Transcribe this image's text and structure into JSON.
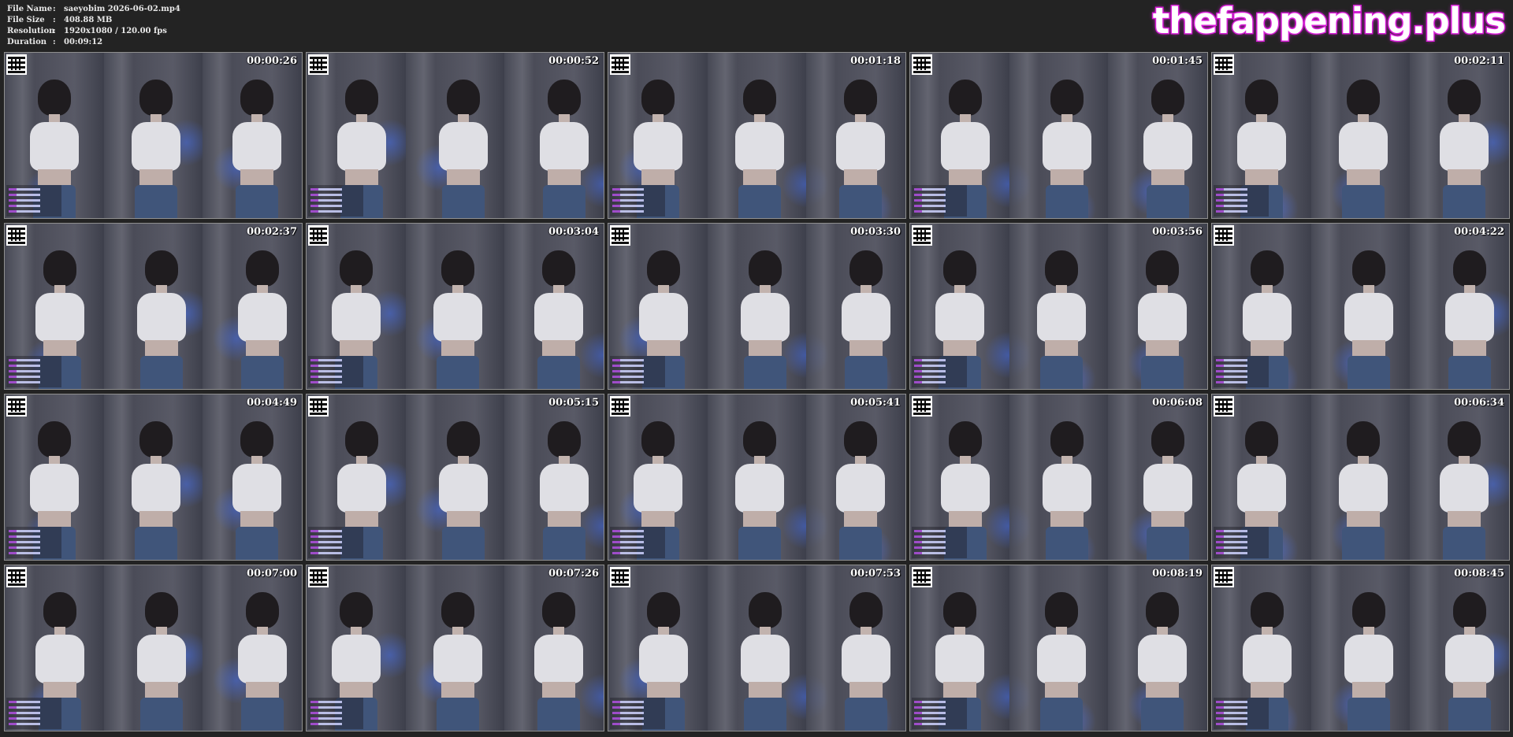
{
  "meta": {
    "file_name_label": "File Name",
    "file_name": "saeyobim 2026-06-02.mp4",
    "file_size_label": "File Size",
    "file_size": "408.88 MB",
    "resolution_label": "Resolution",
    "resolution": "1920x1080 / 120.00 fps",
    "duration_label": "Duration",
    "duration": "00:09:12",
    "separator": ":"
  },
  "watermark": "thefappening.plus",
  "colors": {
    "background": "#232323",
    "watermark_stroke": "#d21cd2",
    "thumb_border": "#8f8f8f"
  },
  "thumbnails": [
    "00:00:26",
    "00:00:52",
    "00:01:18",
    "00:01:45",
    "00:02:11",
    "00:02:37",
    "00:03:04",
    "00:03:30",
    "00:03:56",
    "00:04:22",
    "00:04:49",
    "00:05:15",
    "00:05:41",
    "00:06:08",
    "00:06:34",
    "00:07:00",
    "00:07:26",
    "00:07:53",
    "00:08:19",
    "00:08:45"
  ]
}
